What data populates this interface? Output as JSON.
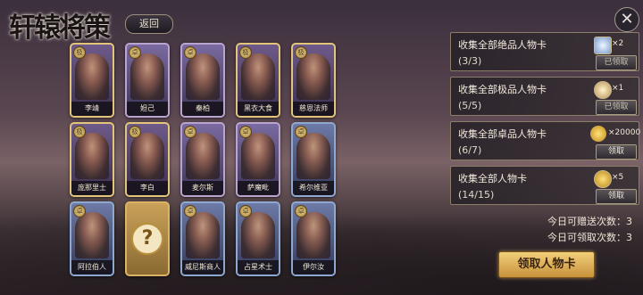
{
  "title": "轩辕将策",
  "back_label": "返回",
  "close_label": "✕",
  "cards": [
    {
      "name": "李靖",
      "tier": "gold",
      "badge": "极"
    },
    {
      "name": "妲己",
      "tier": "purple",
      "badge": "卓"
    },
    {
      "name": "秦柏",
      "tier": "purple",
      "badge": "卓"
    },
    {
      "name": "黑衣大食",
      "tier": "gold",
      "badge": "极"
    },
    {
      "name": "慈恩法师",
      "tier": "gold",
      "badge": "极"
    },
    {
      "name": "庞那里士",
      "tier": "gold",
      "badge": "极"
    },
    {
      "name": "李白",
      "tier": "gold",
      "badge": "极"
    },
    {
      "name": "麦尔斯",
      "tier": "purple",
      "badge": "卓"
    },
    {
      "name": "萨魔毗",
      "tier": "purple",
      "badge": "卓"
    },
    {
      "name": "希尔维亚",
      "tier": "blue",
      "badge": "卓"
    },
    {
      "name": "阿拉伯人",
      "tier": "blue",
      "badge": "卓"
    },
    {
      "name": "",
      "tier": "unknown",
      "badge": ""
    },
    {
      "name": "威尼斯商人",
      "tier": "blue",
      "badge": "卓"
    },
    {
      "name": "占星术士",
      "tier": "blue",
      "badge": "卓"
    },
    {
      "name": "伊尔汝",
      "tier": "blue",
      "badge": "卓"
    }
  ],
  "unknown_mark": "?",
  "rewards": [
    {
      "label": "收集全部绝品人物卡",
      "progress": "(3/3)",
      "icon": "gem-icon",
      "qty": "×2",
      "button": "已领取",
      "claimed": true
    },
    {
      "label": "收集全部极品人物卡",
      "progress": "(5/5)",
      "icon": "token-icon",
      "qty": "×1",
      "button": "已领取",
      "claimed": true
    },
    {
      "label": "收集全部卓品人物卡",
      "progress": "(6/7)",
      "icon": "coins-icon",
      "qty": "×20000",
      "button": "领取",
      "claimed": false
    },
    {
      "label": "收集全部人物卡",
      "progress": "(14/15)",
      "icon": "medal-icon",
      "qty": "×5",
      "button": "领取",
      "claimed": false
    }
  ],
  "gift_count_text": "今日可赠送次数：3",
  "receive_count_text": "今日可领取次数：3",
  "claim_button": "领取人物卡"
}
